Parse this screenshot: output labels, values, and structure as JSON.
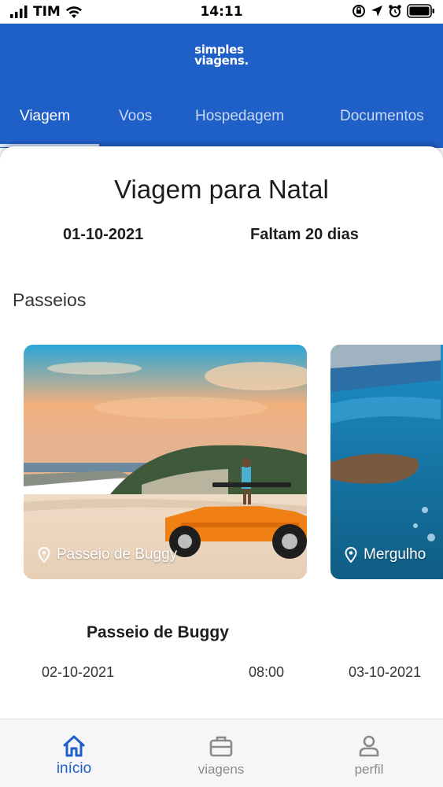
{
  "status_bar": {
    "carrier": "TIM",
    "time": "14:11",
    "icons": [
      "signal-icon",
      "wifi-icon",
      "orientation-lock-icon",
      "location-icon",
      "alarm-icon",
      "battery-icon"
    ]
  },
  "header": {
    "logo_line1": "simples",
    "logo_line2": "viagens.",
    "tabs": [
      {
        "label": "Viagem",
        "active": true
      },
      {
        "label": "Voos",
        "active": false
      },
      {
        "label": "Hospedagem",
        "active": false
      },
      {
        "label": "Documentos",
        "active": false
      }
    ]
  },
  "trip": {
    "title": "Viagem para Natal",
    "date": "01-10-2021",
    "countdown": "Faltam 20 dias"
  },
  "tours": {
    "section_title": "Passeios",
    "items": [
      {
        "label": "Passeio de Buggy"
      },
      {
        "label": "Mergulho"
      }
    ],
    "selected": {
      "name": "Passeio de Buggy",
      "start_date": "02-10-2021",
      "time": "08:00",
      "end_date": "03-10-2021"
    }
  },
  "bottom_nav": {
    "items": [
      {
        "label": "início",
        "icon": "home-icon",
        "active": true
      },
      {
        "label": "viagens",
        "icon": "briefcase-icon",
        "active": false
      },
      {
        "label": "perfil",
        "icon": "user-icon",
        "active": false
      }
    ]
  },
  "colors": {
    "brand_blue": "#1f5fc8",
    "nav_inactive": "#8a8a8a"
  }
}
